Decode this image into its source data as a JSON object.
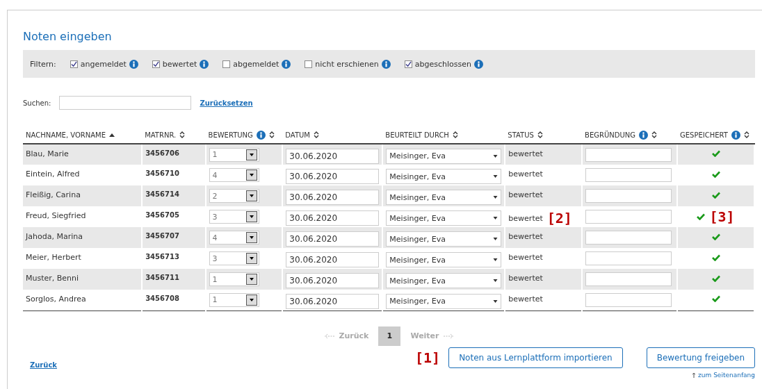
{
  "title": "Noten eingeben",
  "filter": {
    "label": "Filtern:",
    "options": [
      {
        "label": "angemeldet",
        "checked": true
      },
      {
        "label": "bewertet",
        "checked": true
      },
      {
        "label": "abgemeldet",
        "checked": false
      },
      {
        "label": "nicht erschienen",
        "checked": false
      },
      {
        "label": "abgeschlossen",
        "checked": true
      }
    ]
  },
  "search": {
    "label": "Suchen:",
    "reset": "Zurücksetzen"
  },
  "table": {
    "columns": [
      {
        "label": "NACHNAME, VORNAME",
        "info": false,
        "sorted": true
      },
      {
        "label": "MATRNR.",
        "info": false,
        "sorted": false
      },
      {
        "label": "BEWERTUNG",
        "info": true,
        "sorted": false
      },
      {
        "label": "DATUM",
        "info": false,
        "sorted": false
      },
      {
        "label": "BEURTEILT DURCH",
        "info": false,
        "sorted": false
      },
      {
        "label": "STATUS",
        "info": false,
        "sorted": false
      },
      {
        "label": "BEGRÜNDUNG",
        "info": true,
        "sorted": false
      },
      {
        "label": "GESPEICHERT",
        "info": true,
        "sorted": false
      }
    ],
    "rows": [
      {
        "name": "Blau, Marie",
        "matrnr": "3456706",
        "grade": "1",
        "date": "30.06.2020",
        "rater": "Meisinger, Eva",
        "status": "bewertet",
        "saved": true
      },
      {
        "name": "Eintein, Alfred",
        "matrnr": "3456710",
        "grade": "4",
        "date": "30.06.2020",
        "rater": "Meisinger, Eva",
        "status": "bewertet",
        "saved": true
      },
      {
        "name": "Fleißig, Carina",
        "matrnr": "3456714",
        "grade": "2",
        "date": "30.06.2020",
        "rater": "Meisinger, Eva",
        "status": "bewertet",
        "saved": true
      },
      {
        "name": "Freud, Siegfried",
        "matrnr": "3456705",
        "grade": "3",
        "date": "30.06.2020",
        "rater": "Meisinger, Eva",
        "status": "bewertet",
        "saved": true,
        "status_callout": "[2]",
        "saved_callout": "[3]"
      },
      {
        "name": "Jahoda, Marina",
        "matrnr": "3456707",
        "grade": "4",
        "date": "30.06.2020",
        "rater": "Meisinger, Eva",
        "status": "bewertet",
        "saved": true
      },
      {
        "name": "Meier, Herbert",
        "matrnr": "3456713",
        "grade": "3",
        "date": "30.06.2020",
        "rater": "Meisinger, Eva",
        "status": "bewertet",
        "saved": true
      },
      {
        "name": "Muster, Benni",
        "matrnr": "3456711",
        "grade": "1",
        "date": "30.06.2020",
        "rater": "Meisinger, Eva",
        "status": "bewertet",
        "saved": true
      },
      {
        "name": "Sorglos, Andrea",
        "matrnr": "3456708",
        "grade": "1",
        "date": "30.06.2020",
        "rater": "Meisinger, Eva",
        "status": "bewertet",
        "saved": true
      }
    ]
  },
  "pagination": {
    "prev": "Zurück",
    "pages": [
      {
        "label": "1",
        "selected": true
      }
    ],
    "next": "Weiter"
  },
  "footer": {
    "back": "Zurück",
    "import_callout": "[1]",
    "import": "Noten aus Lernplattform importieren",
    "release": "Bewertung freigeben",
    "top": "zum Seitenanfang"
  }
}
